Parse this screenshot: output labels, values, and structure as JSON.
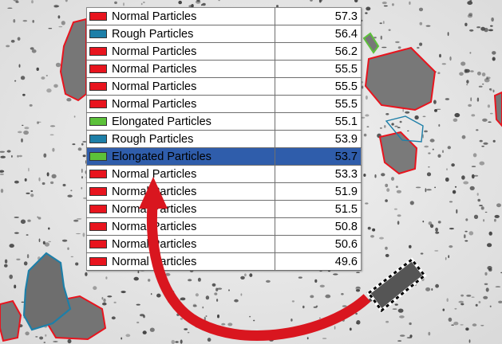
{
  "particles": [
    {
      "label": "Normal Particles",
      "value": "57.3",
      "color": "#e8141e"
    },
    {
      "label": "Rough Particles",
      "value": "56.4",
      "color": "#1d7fa8"
    },
    {
      "label": "Normal Particles",
      "value": "56.2",
      "color": "#e8141e"
    },
    {
      "label": "Normal Particles",
      "value": "55.5",
      "color": "#e8141e"
    },
    {
      "label": "Normal Particles",
      "value": "55.5",
      "color": "#e8141e"
    },
    {
      "label": "Normal Particles",
      "value": "55.5",
      "color": "#e8141e"
    },
    {
      "label": "Elongated Particles",
      "value": "55.1",
      "color": "#5cc13a"
    },
    {
      "label": "Rough Particles",
      "value": "53.9",
      "color": "#1d7fa8"
    },
    {
      "label": "Elongated Particles",
      "value": "53.7",
      "color": "#5cc13a",
      "selected": true
    },
    {
      "label": "Normal Particles",
      "value": "53.3",
      "color": "#e8141e"
    },
    {
      "label": "Normal Particles",
      "value": "51.9",
      "color": "#e8141e"
    },
    {
      "label": "Normal Particles",
      "value": "51.5",
      "color": "#e8141e"
    },
    {
      "label": "Normal Particles",
      "value": "50.8",
      "color": "#e8141e"
    },
    {
      "label": "Normal Particles",
      "value": "50.6",
      "color": "#e8141e"
    },
    {
      "label": "Normal Particles",
      "value": "49.6",
      "color": "#e8141e"
    }
  ],
  "colors": {
    "normal_outline": "#e8141e",
    "rough_outline": "#1d7fa8",
    "elongated_outline": "#5cc13a",
    "selection": "#2f5dab",
    "arrow": "#d9161f"
  }
}
